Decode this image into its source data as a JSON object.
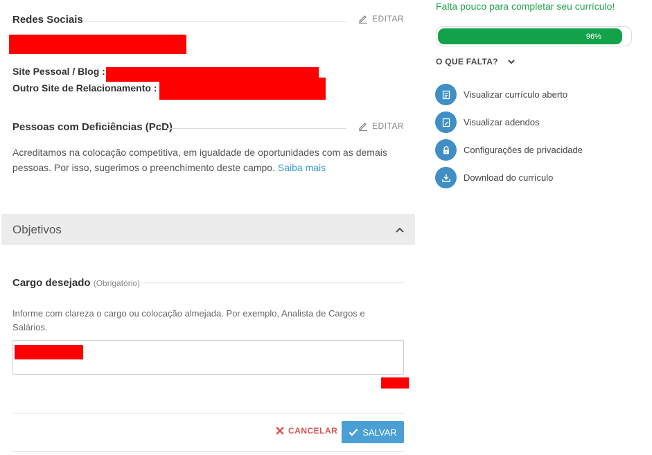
{
  "social": {
    "title": "Redes Sociais",
    "edit_label": "EDITAR",
    "site_label": "Site Pessoal / Blog :",
    "other_label": "Outro Site de Relacionamento :"
  },
  "pcd": {
    "title": "Pessoas com Deficiências (PcD)",
    "edit_label": "EDITAR",
    "text": "Acreditamos na colocação competitiva, em igualdade de oportunidades com as demais pessoas. Por isso, sugerimos o preenchimento deste campo.",
    "link": "Saiba mais"
  },
  "objectives": {
    "accordion_title": "Objetivos",
    "cargo_title": "Cargo desejado",
    "cargo_required": "(Obrigatório)",
    "hint": "Informe com clareza o cargo ou colocação almejada. Por exemplo, Analista de Cargos e Salários.",
    "cancel_label": "CANCELAR",
    "save_label": "SALVAR"
  },
  "progress": {
    "headline": "Falta pouco para completar seu currículo!",
    "value_percent": 96,
    "percent_label": "96%",
    "missing_title": "O QUE FALTA?"
  },
  "actions": [
    {
      "label": "Visualizar currículo aberto",
      "icon": "document-icon"
    },
    {
      "label": "Visualizar adendos",
      "icon": "addendum-icon"
    },
    {
      "label": "Configurações de privacidade",
      "icon": "lock-icon"
    },
    {
      "label": "Download do currículo",
      "icon": "download-icon"
    }
  ],
  "colors": {
    "accent_green": "#13a24a",
    "link_blue": "#3b9bd3",
    "button_blue": "#4a9fd5",
    "cancel_red": "#d9534f",
    "icon_blue": "#3f8ec6"
  }
}
